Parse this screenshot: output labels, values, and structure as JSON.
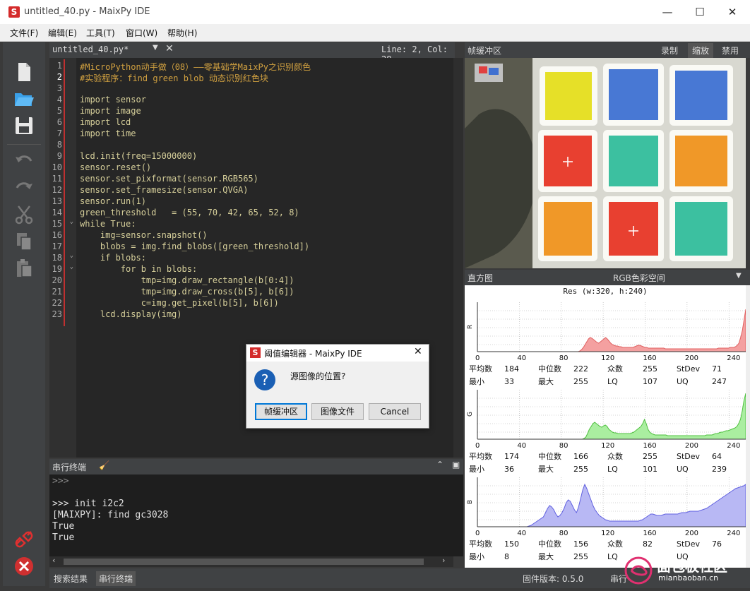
{
  "window": {
    "title": "untitled_40.py - MaixPy IDE",
    "logo": "S",
    "minimize": "—",
    "maximize": "☐",
    "close": "✕"
  },
  "menu": [
    "文件(F)",
    "编辑(E)",
    "工具(T)",
    "窗口(W)",
    "帮助(H)"
  ],
  "editor": {
    "tab": "untitled_40.py*",
    "cursor": "Line: 2, Col: 28",
    "lines": [
      "#MicroPython动手做（08）——零基础学MaixPy之识别颜色",
      "#实验程序：find green blob 动态识别红色块",
      "",
      "import sensor",
      "import image",
      "import lcd",
      "import time",
      "",
      "lcd.init(freq=15000000)",
      "sensor.reset()",
      "sensor.set_pixformat(sensor.RGB565)",
      "sensor.set_framesize(sensor.QVGA)",
      "sensor.run(1)",
      "green_threshold   = (55, 70, 42, 65, 52, 8)",
      "while True:",
      "    img=sensor.snapshot()",
      "    blobs = img.find_blobs([green_threshold])",
      "    if blobs:",
      "        for b in blobs:",
      "            tmp=img.draw_rectangle(b[0:4])",
      "            tmp=img.draw_cross(b[5], b[6])",
      "            c=img.get_pixel(b[5], b[6])",
      "    lcd.display(img)"
    ]
  },
  "serial": {
    "title": "串行终端",
    "lines": [
      ">>>",
      "",
      ">>> init i2c2",
      "[MAIXPY]: find gc3028",
      "True",
      "True"
    ]
  },
  "bottom_tabs": [
    "搜索结果",
    "串行终端"
  ],
  "status": {
    "firmware": "固件版本: 0.5.0",
    "serial": "串行"
  },
  "framebuffer": {
    "title": "帧缓冲区",
    "record": "录制",
    "zoom": "缩放",
    "disable": "禁用"
  },
  "histogram": {
    "title": "直方图",
    "colorspace": "RGB色彩空间",
    "res": "Res (w:320, h:240)",
    "ticks": [
      "0",
      "40",
      "80",
      "120",
      "160",
      "200",
      "240"
    ],
    "channels": [
      {
        "axis": "R",
        "color": "#f4a0a0",
        "line": "#e06060",
        "stats": {
          "mean": "184",
          "median": "222",
          "mode": "255",
          "stdev": "71",
          "min": "33",
          "max": "255",
          "lq": "107",
          "uq": "247"
        },
        "values": [
          0,
          0,
          0,
          0,
          0,
          0,
          0,
          0,
          0,
          0,
          0,
          0,
          0,
          0,
          0,
          0,
          0,
          0,
          0,
          0,
          0,
          0,
          0,
          0,
          0,
          0,
          0,
          0,
          0,
          0,
          0,
          0,
          0,
          0,
          0,
          0,
          0,
          0,
          0,
          0,
          0,
          0,
          0,
          0,
          0,
          0,
          0,
          0,
          0,
          0,
          0,
          0,
          0,
          0,
          0,
          0,
          0,
          0,
          0,
          0,
          1,
          3,
          6,
          10,
          14,
          18,
          20,
          19,
          17,
          15,
          13,
          12,
          14,
          16,
          18,
          20,
          18,
          15,
          12,
          10,
          9,
          8,
          8,
          7,
          7,
          6,
          6,
          6,
          6,
          6,
          6,
          6,
          7,
          8,
          9,
          9,
          8,
          7,
          6,
          6,
          5,
          5,
          5,
          5,
          5,
          5,
          5,
          5,
          5,
          5,
          4,
          4,
          4,
          4,
          4,
          4,
          4,
          4,
          4,
          4,
          4,
          4,
          4,
          4,
          4,
          4,
          4,
          4,
          4,
          4,
          4,
          4,
          4,
          4,
          4,
          4,
          4,
          4,
          4,
          4,
          4,
          5,
          5,
          5,
          5,
          5,
          5,
          5,
          6,
          6,
          6,
          7,
          9,
          12,
          20,
          30,
          45,
          60
        ]
      },
      {
        "axis": "G",
        "color": "#aaeea0",
        "line": "#50c040",
        "stats": {
          "mean": "174",
          "median": "166",
          "mode": "255",
          "stdev": "64",
          "min": "36",
          "max": "255",
          "lq": "101",
          "uq": "239"
        },
        "values": [
          0,
          0,
          0,
          0,
          0,
          0,
          0,
          0,
          0,
          0,
          0,
          0,
          0,
          0,
          0,
          0,
          0,
          0,
          0,
          0,
          0,
          0,
          0,
          0,
          0,
          0,
          0,
          0,
          0,
          0,
          0,
          0,
          0,
          0,
          0,
          0,
          0,
          0,
          0,
          0,
          0,
          0,
          0,
          0,
          0,
          0,
          0,
          0,
          0,
          0,
          0,
          0,
          0,
          0,
          0,
          0,
          0,
          0,
          0,
          0,
          1,
          3,
          8,
          14,
          18,
          22,
          24,
          22,
          20,
          18,
          17,
          19,
          20,
          18,
          14,
          12,
          10,
          9,
          9,
          8,
          8,
          8,
          8,
          8,
          8,
          8,
          8,
          9,
          10,
          12,
          14,
          16,
          18,
          22,
          28,
          22,
          14,
          10,
          8,
          7,
          6,
          6,
          6,
          6,
          6,
          6,
          6,
          5,
          5,
          5,
          5,
          5,
          5,
          5,
          5,
          5,
          5,
          5,
          5,
          5,
          5,
          5,
          5,
          5,
          5,
          5,
          5,
          5,
          5,
          6,
          6,
          6,
          6,
          7,
          8,
          8,
          9,
          10,
          10,
          11,
          12,
          12,
          13,
          14,
          15,
          16,
          18,
          22,
          28,
          40,
          55,
          65
        ]
      },
      {
        "axis": "B",
        "color": "#b8b8f4",
        "line": "#6060e0",
        "stats": {
          "mean": "150",
          "median": "156",
          "mode": "82",
          "stdev": "76",
          "min": "8",
          "max": "255",
          "lq": "",
          "uq": ""
        },
        "values": [
          0,
          0,
          0,
          0,
          0,
          0,
          0,
          0,
          0,
          0,
          0,
          0,
          0,
          0,
          0,
          0,
          0,
          0,
          0,
          0,
          0,
          0,
          0,
          0,
          0,
          1,
          2,
          4,
          6,
          8,
          10,
          12,
          14,
          20,
          26,
          30,
          28,
          24,
          18,
          14,
          16,
          20,
          26,
          34,
          38,
          36,
          30,
          24,
          20,
          28,
          40,
          52,
          60,
          54,
          46,
          38,
          30,
          24,
          20,
          16,
          14,
          12,
          10,
          9,
          8,
          8,
          8,
          8,
          8,
          8,
          8,
          8,
          8,
          8,
          8,
          8,
          8,
          8,
          8,
          9,
          10,
          12,
          14,
          16,
          18,
          18,
          17,
          16,
          16,
          16,
          17,
          18,
          18,
          18,
          18,
          18,
          18,
          18,
          19,
          20,
          20,
          20,
          21,
          22,
          22,
          22,
          22,
          22,
          23,
          24,
          25,
          26,
          28,
          30,
          32,
          34,
          36,
          38,
          40,
          42,
          44,
          46,
          48,
          50,
          52,
          54,
          55,
          56,
          57,
          58,
          60
        ]
      }
    ],
    "labels": {
      "mean": "平均数",
      "median": "中位数",
      "mode": "众数",
      "stdev": "StDev",
      "min": "最小",
      "max": "最大",
      "lq": "LQ",
      "uq": "UQ"
    }
  },
  "dialog": {
    "title": "阈值编辑器 - MaixPy IDE",
    "message": "源图像的位置?",
    "buttons": [
      "帧缓冲区",
      "图像文件",
      "Cancel"
    ]
  },
  "watermark": {
    "text": "面包板社区",
    "url": "mianbaoban.cn"
  }
}
